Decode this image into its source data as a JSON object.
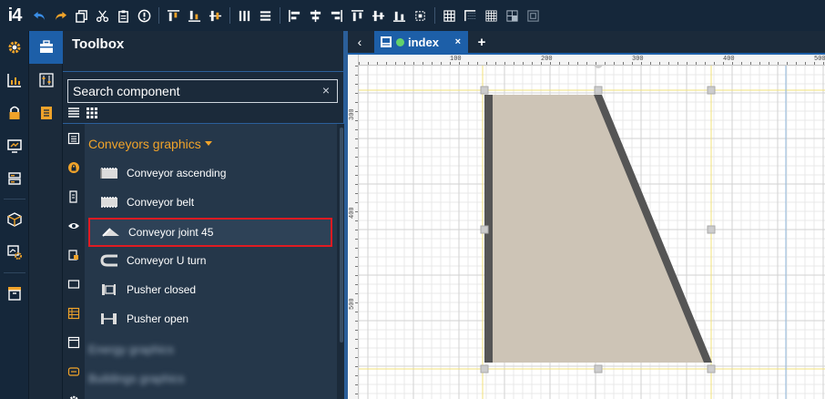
{
  "app": {
    "logo": "i4"
  },
  "toolbar": {
    "icons": [
      "undo-icon",
      "redo-icon",
      "copy-icon",
      "cut-icon",
      "paste-icon",
      "info-icon",
      "align-top-icon",
      "align-bottom-icon",
      "align-middle-icon",
      "distribute-h-icon",
      "distribute-v-icon",
      "align-left-icon",
      "align-center-icon",
      "align-right-icon",
      "align-top-edge-icon",
      "align-vcenter-icon",
      "align-bottom-edge-icon",
      "same-size-icon",
      "grid-icon",
      "grid-corner-icon",
      "grid-fine-icon",
      "grid-snap-icon",
      "grid-off-icon"
    ]
  },
  "toolbox": {
    "title": "Toolbox",
    "search_placeholder": "Search component",
    "search_clear": "×",
    "category": "Conveyors graphics",
    "items": [
      {
        "label": "Conveyor ascending"
      },
      {
        "label": "Conveyor belt"
      },
      {
        "label": "Conveyor joint 45",
        "selected": true
      },
      {
        "label": "Conveyor U turn"
      },
      {
        "label": "Pusher closed"
      },
      {
        "label": "Pusher open"
      }
    ],
    "blurred_items": [
      "Energy graphics",
      "Buildings graphics"
    ]
  },
  "tabs": {
    "back": "‹",
    "active": "index",
    "close": "×",
    "add": "+"
  },
  "canvas": {
    "ruler_h": [
      "100",
      "200",
      "300",
      "400",
      "500"
    ],
    "ruler_v": [
      "300",
      "400",
      "500"
    ],
    "shape_fill": "#cdc4b6",
    "shape_edge": "#555555"
  }
}
